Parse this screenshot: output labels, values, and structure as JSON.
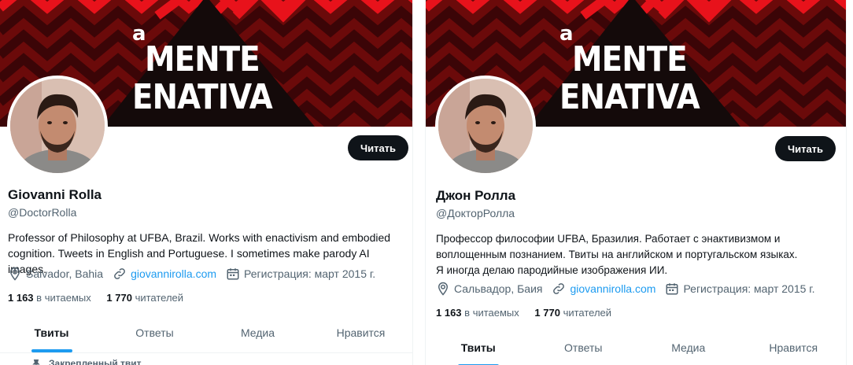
{
  "colors": {
    "accent": "#1d9bf0",
    "text": "#0f1419",
    "muted": "#536471",
    "banner": "#6b0a0a"
  },
  "banner": {
    "logo_a": "a",
    "logo_line1": "MENTE",
    "logo_line2": "ENATIVA"
  },
  "panels": [
    {
      "follow_label": "Читать",
      "name": "Giovanni Rolla",
      "handle": "@DoctorRolla",
      "bio": "Professor of Philosophy at UFBA, Brazil. Works with enactivism and embodied cognition. Tweets in English and Portuguese. I sometimes make parody AI images.",
      "location": "Salvador, Bahia",
      "link": "giovannirolla.com",
      "joined": "Регистрация: март 2015 г.",
      "following_count": "1 163",
      "following_label": "в читаемых",
      "followers_count": "1 770",
      "followers_label": "читателей",
      "tabs": [
        "Твиты",
        "Ответы",
        "Медиа",
        "Нравится"
      ],
      "pinned": "Закрепленный твит",
      "icons": [
        "location-icon",
        "link-icon",
        "calendar-icon",
        "pin-icon"
      ]
    },
    {
      "follow_label": "Читать",
      "name": "Джон Ролла",
      "handle": "@ДокторРолла",
      "bio": "Профессор философии UFBA, Бразилия. Работает с энактивизмом и воплощенным познанием. Твиты на английском и португальском языках. Я иногда делаю пародийные изображения ИИ.",
      "location": "Сальвадор, Баия",
      "link": "giovannirolla.com",
      "joined": "Регистрация: март 2015 г.",
      "following_count": "1 163",
      "following_label": "в читаемых",
      "followers_count": "1 770",
      "followers_label": "читателей",
      "tabs": [
        "Твиты",
        "Ответы",
        "Медиа",
        "Нравится"
      ],
      "icons": [
        "location-icon",
        "link-icon",
        "calendar-icon"
      ]
    }
  ]
}
